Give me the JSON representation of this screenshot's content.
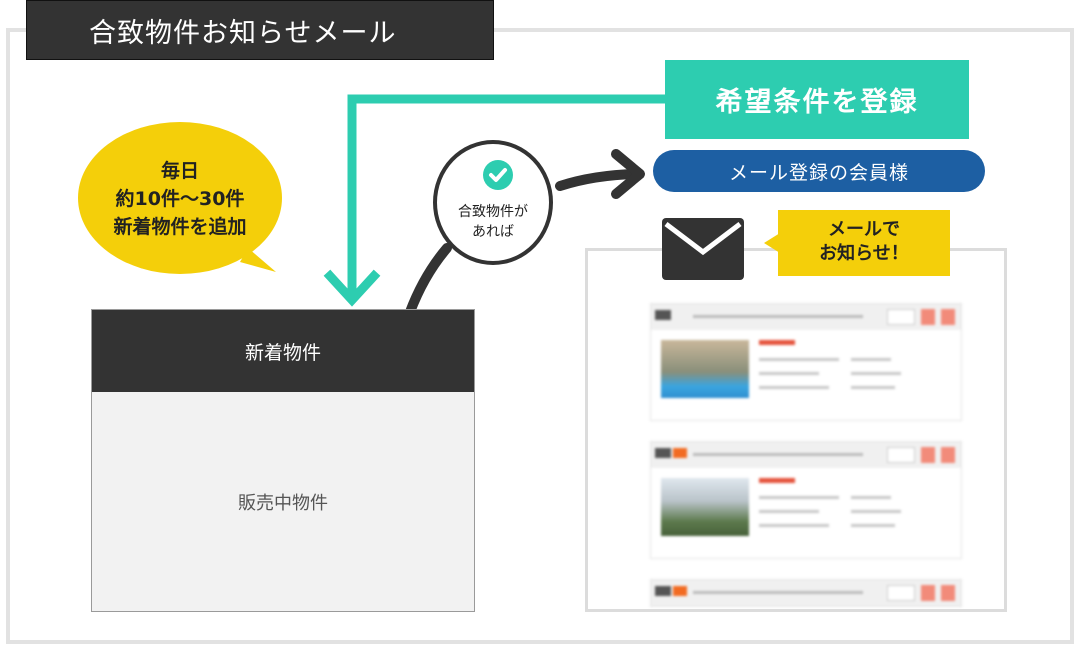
{
  "title": "合致物件お知らせメール",
  "register_button": "希望条件を登録",
  "member_label": "メール登録の会員様",
  "daily_bubble": {
    "line1": "毎日",
    "line2": "約10件〜30件",
    "line3": "新着物件を追加"
  },
  "match_circle": {
    "line1": "合致物件が",
    "line2": "あれば"
  },
  "listing": {
    "header": "新着物件",
    "body": "販売中物件"
  },
  "mail_badge": {
    "line1": "メールで",
    "line2": "お知らせ！"
  },
  "colors": {
    "accent_teal": "#2dcdb0",
    "navy": "#1d5fa3",
    "yellow": "#f4cf0a",
    "dark": "#333333"
  },
  "icons": [
    "check-icon",
    "envelope-icon",
    "arrow-icon"
  ]
}
